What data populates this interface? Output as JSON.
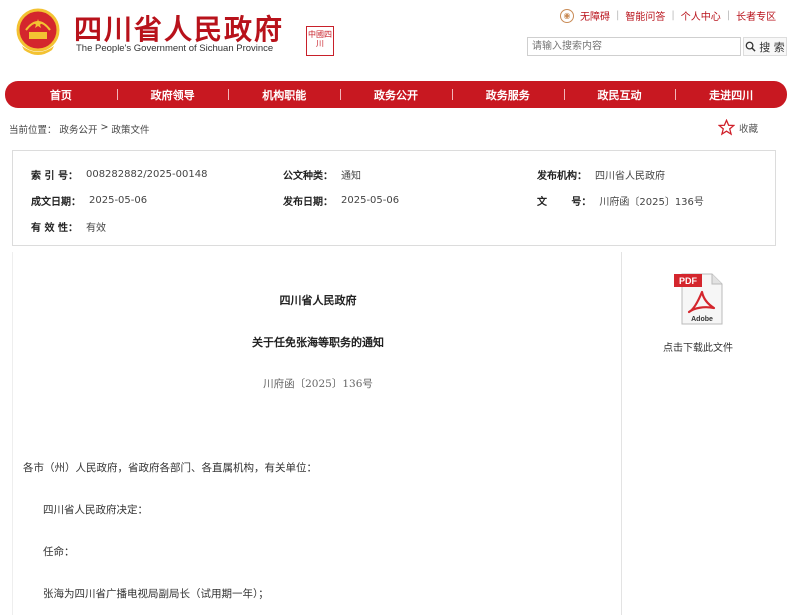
{
  "header": {
    "title_cn": "四川省人民政府",
    "title_en": "The People's Government of Sichuan Province",
    "seal_text": "中國四川",
    "top_links": [
      "无障碍",
      "智能问答",
      "个人中心",
      "长者专区"
    ],
    "search_placeholder": "请输入搜索内容",
    "search_button": "搜 索"
  },
  "nav": {
    "items": [
      "首页",
      "政府领导",
      "机构职能",
      "政务公开",
      "政务服务",
      "政民互动",
      "走进四川"
    ]
  },
  "breadcrumb": {
    "prefix": "当前位置：",
    "items": [
      "政务公开",
      ">",
      "政策文件"
    ]
  },
  "favorite_label": "收藏",
  "meta": {
    "index_label": "索 引 号：",
    "index_value": "008282882/2025-00148",
    "type_label": "公文种类：",
    "type_value": "通知",
    "issuer_label": "发布机构：",
    "issuer_value": "四川省人民政府",
    "written_label": "成文日期：",
    "written_value": "2025-05-06",
    "published_label": "发布日期：",
    "published_value": "2025-05-06",
    "docno_label": "文       号：",
    "docno_value": "川府函〔2025〕136号",
    "validity_label": "有 效 性：",
    "validity_value": "有效"
  },
  "document": {
    "issuer": "四川省人民政府",
    "title": "关于任免张海等职务的通知",
    "number": "川府函〔2025〕136号",
    "paragraphs": [
      "各市（州）人民政府，省政府各部门、各直属机构，有关单位：",
      "四川省人民政府决定：",
      "任命：",
      "张海为四川省广播电视局副局长（试用期一年）；"
    ]
  },
  "download": {
    "icon_label": "PDF",
    "icon_brand": "Adobe",
    "label": "点击下载此文件"
  },
  "colors": {
    "brand_red": "#c81821",
    "title_red": "#b8121b"
  }
}
